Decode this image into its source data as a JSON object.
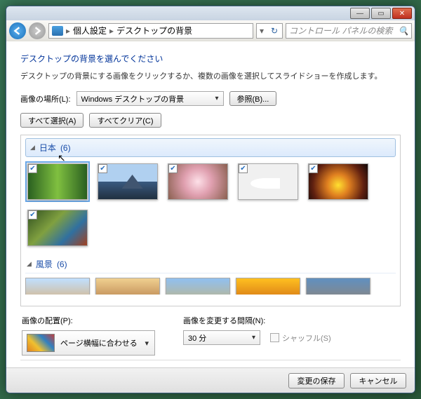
{
  "breadcrumb": {
    "seg1": "個人設定",
    "seg2": "デスクトップの背景"
  },
  "search": {
    "placeholder": "コントロール パネルの検索"
  },
  "heading": "デスクトップの背景を選んでください",
  "description": "デスクトップの背景にする画像をクリックするか、複数の画像を選択してスライドショーを作成します。",
  "location": {
    "label": "画像の場所(L):",
    "value": "Windows デスクトップの背景",
    "browse": "参照(B)..."
  },
  "selbuttons": {
    "all": "すべて選択(A)",
    "clear": "すべてクリア(C)"
  },
  "groups": [
    {
      "name": "日本",
      "count": "(6)",
      "images": 6
    },
    {
      "name": "風景",
      "count": "(6)",
      "images": 5
    }
  ],
  "position": {
    "label": "画像の配置(P):",
    "value": "ページ横幅に合わせる"
  },
  "interval": {
    "label": "画像を変更する間隔(N):",
    "value": "30 分"
  },
  "shuffle": {
    "label": "シャッフル(S)"
  },
  "footer": {
    "save": "変更の保存",
    "cancel": "キャンセル"
  }
}
